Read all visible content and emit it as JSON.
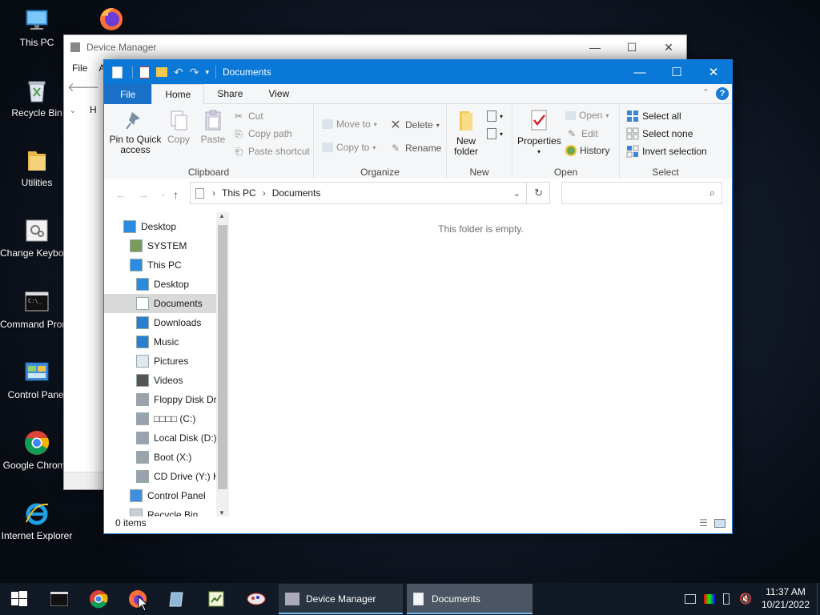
{
  "desktop": {
    "icons": [
      {
        "label": "This PC",
        "icon": "this-pc-icon"
      },
      {
        "label": "Recycle Bin",
        "icon": "recycle-bin-icon"
      },
      {
        "label": "Utilities",
        "icon": "folder-icon"
      },
      {
        "label": "Change Keyboard Layout",
        "icon": "keyboard-layout-icon"
      },
      {
        "label": "Command Prompt",
        "icon": "command-prompt-icon"
      },
      {
        "label": "Control Panel",
        "icon": "control-panel-icon"
      },
      {
        "label": "Google Chrome",
        "icon": "chrome-icon"
      },
      {
        "label": "Internet Explorer",
        "icon": "ie-icon"
      }
    ],
    "top_icon": "firefox-icon"
  },
  "device_manager": {
    "title": "Device Manager",
    "menu": [
      "File",
      "A"
    ],
    "partial_label": "H"
  },
  "explorer": {
    "title": "Documents",
    "tabs": [
      "File",
      "Home",
      "Share",
      "View"
    ],
    "ribbon": {
      "clipboard": {
        "label": "Clipboard",
        "pin": "Pin to Quick access",
        "copy": "Copy",
        "paste": "Paste",
        "cut": "Cut",
        "copy_path": "Copy path",
        "paste_shortcut": "Paste shortcut"
      },
      "organize": {
        "label": "Organize",
        "move_to": "Move to",
        "copy_to": "Copy to",
        "delete": "Delete",
        "rename": "Rename"
      },
      "new": {
        "label": "New",
        "new_folder": "New folder"
      },
      "open": {
        "label": "Open",
        "properties": "Properties",
        "open": "Open",
        "edit": "Edit",
        "history": "History"
      },
      "select": {
        "label": "Select",
        "select_all": "Select all",
        "select_none": "Select none",
        "invert": "Invert selection"
      }
    },
    "address": {
      "crumbs": [
        "This PC",
        "Documents"
      ],
      "search_placeholder": ""
    },
    "nav": [
      {
        "label": "Desktop",
        "indent": 0
      },
      {
        "label": "SYSTEM",
        "indent": 1
      },
      {
        "label": "This PC",
        "indent": 1
      },
      {
        "label": "Desktop",
        "indent": 2
      },
      {
        "label": "Documents",
        "indent": 2,
        "selected": true
      },
      {
        "label": "Downloads",
        "indent": 2
      },
      {
        "label": "Music",
        "indent": 2
      },
      {
        "label": "Pictures",
        "indent": 2
      },
      {
        "label": "Videos",
        "indent": 2
      },
      {
        "label": "Floppy Disk Dri",
        "indent": 2
      },
      {
        "label": "□□□□ (C:)",
        "indent": 2
      },
      {
        "label": "Local Disk (D:)",
        "indent": 2
      },
      {
        "label": "Boot (X:)",
        "indent": 2
      },
      {
        "label": "CD Drive (Y:) H",
        "indent": 2
      },
      {
        "label": "Control Panel",
        "indent": 1
      },
      {
        "label": "Recycle Bin",
        "indent": 1
      }
    ],
    "empty_message": "This folder is empty.",
    "status": "0 items"
  },
  "taskbar": {
    "tasks": [
      {
        "label": "Device Manager"
      },
      {
        "label": "Documents"
      }
    ],
    "time": "11:37 AM",
    "date": "10/21/2022"
  },
  "colors": {
    "accent": "#0a78d7",
    "taskbar": "#101924"
  }
}
